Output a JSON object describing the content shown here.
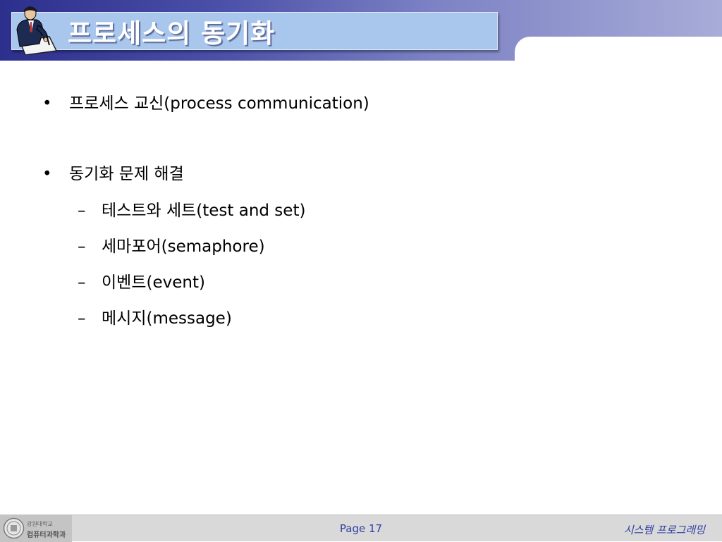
{
  "header": {
    "title": "프로세스의 동기화"
  },
  "content": {
    "bullets": [
      {
        "marker": "•",
        "text": "프로세스 교신(process communication)"
      },
      {
        "marker": "•",
        "text": "동기화 문제 해결"
      }
    ],
    "sub_bullets": [
      {
        "marker": "–",
        "text": "테스트와 세트(test and set)"
      },
      {
        "marker": "–",
        "text": "세마포어(semaphore)"
      },
      {
        "marker": "–",
        "text": "이벤트(event)"
      },
      {
        "marker": "–",
        "text": "메시지(message)"
      }
    ]
  },
  "footer": {
    "logo_line1": "강원대학교",
    "logo_line2": "컴퓨터과학과",
    "page": "Page 17",
    "course": "시스템 프로그래밍"
  },
  "colors": {
    "header_dark": "#2c2f8c",
    "title_box": "#a9c6ec",
    "footer_text": "#2f3fa0",
    "footer_bg": "#d9d9d9"
  },
  "icons": {
    "header": "person-writing-icon",
    "footer": "university-seal-icon"
  }
}
